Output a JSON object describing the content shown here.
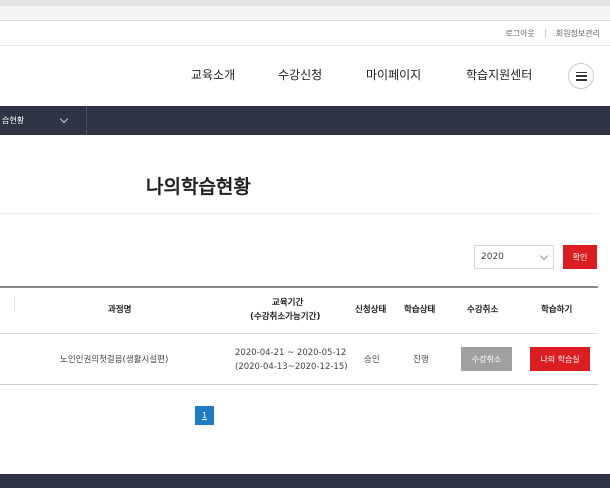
{
  "header": {
    "util_links": [
      "로그아웃",
      "회원정보관리"
    ],
    "nav_items": [
      "교육소개",
      "수강신청",
      "마이페이지",
      "학습지원센터"
    ],
    "menu_icon": "hamburger-icon"
  },
  "subnav": {
    "breadcrumb": "습현황",
    "chevron_icon": "chevron-down-icon"
  },
  "page": {
    "title": "나의학습현황"
  },
  "filter": {
    "year": "2020",
    "confirm_label": "확인"
  },
  "table": {
    "headers": {
      "course": "과정명",
      "period_line1": "교육기간",
      "period_line2": "(수강취소가능기간)",
      "application_status": "신청상태",
      "learning_status": "학습상태",
      "cancel": "수강취소",
      "study": "학습하기"
    },
    "rows": [
      {
        "course": "노인인권의첫걸음(생활시설편)",
        "period": "2020-04-21 ~ 2020-05-12",
        "cancel_period": "(2020-04-13~2020-12-15)",
        "application_status": "승인",
        "learning_status": "진행",
        "cancel_label": "수강취소",
        "study_label": "나의 학습실"
      }
    ]
  },
  "pagination": {
    "current": "1"
  },
  "colors": {
    "accent": "#dc1e23",
    "navbar": "#2e3443",
    "page_active": "#1c7cc4",
    "cancel_button": "#a0a0a0"
  }
}
